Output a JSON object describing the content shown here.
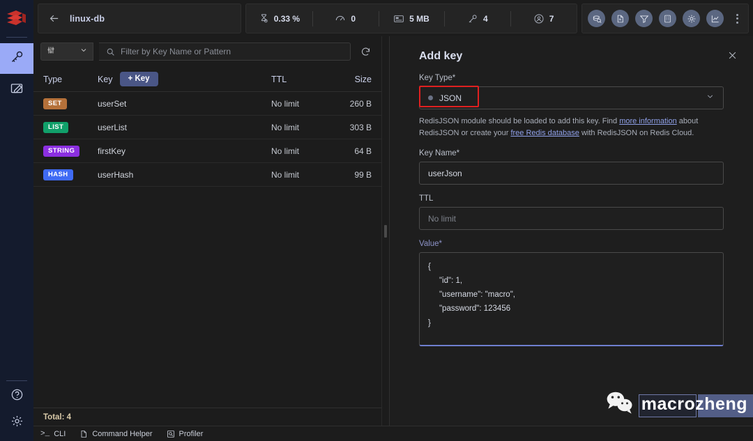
{
  "rail": {
    "logo_icon": "redis-logo",
    "items": [
      {
        "name": "browser",
        "icon": "key-icon",
        "active": true
      },
      {
        "name": "workbench",
        "icon": "edit-icon",
        "active": false
      }
    ],
    "bottom_items": [
      {
        "name": "help",
        "icon": "help-icon"
      },
      {
        "name": "settings",
        "icon": "gear-icon"
      }
    ]
  },
  "topbar": {
    "back_icon": "arrow-left-icon",
    "db_name": "linux-db",
    "stats": [
      {
        "icon": "hourglass-icon",
        "value": "0.33 %"
      },
      {
        "icon": "gauge-icon",
        "value": "0"
      },
      {
        "icon": "memory-icon",
        "value": "5 MB"
      },
      {
        "icon": "key-icon",
        "value": "4"
      },
      {
        "icon": "user-icon",
        "value": "7"
      }
    ],
    "tools": [
      {
        "name": "database-overview",
        "icon": "overview-icon"
      },
      {
        "name": "slowlog",
        "icon": "document-icon"
      },
      {
        "name": "pub-sub",
        "icon": "funnel-icon"
      },
      {
        "name": "cluster-details",
        "icon": "grid-icon"
      },
      {
        "name": "settings",
        "icon": "gear-icon"
      },
      {
        "name": "analysis-tools",
        "icon": "chart-icon"
      }
    ],
    "more_icon": "more-vertical-icon"
  },
  "keys_pane": {
    "filter": {
      "select_icon": "filter-icon",
      "caret_icon": "chevron-down-icon",
      "search_icon": "search-icon",
      "placeholder": "Filter by Key Name or Pattern",
      "value": "",
      "refresh_icon": "refresh-icon"
    },
    "columns": [
      "Type",
      "Key",
      "TTL",
      "Size"
    ],
    "add_key_label": "+ Key",
    "rows": [
      {
        "type": "SET",
        "type_color": "#b5713a",
        "key": "userSet",
        "ttl": "No limit",
        "size": "260 B"
      },
      {
        "type": "LIST",
        "type_color": "#11a06a",
        "key": "userList",
        "ttl": "No limit",
        "size": "303 B"
      },
      {
        "type": "STRING",
        "type_color": "#8b2fe0",
        "key": "firstKey",
        "ttl": "No limit",
        "size": "64 B"
      },
      {
        "type": "HASH",
        "type_color": "#3f6bf5",
        "key": "userHash",
        "ttl": "No limit",
        "size": "99 B"
      }
    ],
    "total_label": "Total: 4"
  },
  "panel": {
    "title": "Add key",
    "close_icon": "close-icon",
    "key_type": {
      "label": "Key Type*",
      "value": "JSON",
      "caret_icon": "chevron-down-icon",
      "highlight_color": "#e02020"
    },
    "helper": {
      "part1": "RedisJSON module should be loaded to add this key. Find ",
      "link1": "more information",
      "part2": " about RedisJSON or create your ",
      "link2": "free Redis database",
      "part3": " with RedisJSON on Redis Cloud."
    },
    "key_name": {
      "label": "Key Name*",
      "value": "userJson"
    },
    "ttl": {
      "label": "TTL",
      "placeholder": "No limit",
      "value": ""
    },
    "value_field": {
      "label": "Value*",
      "value": "{\n     \"id\": 1,\n     \"username\": \"macro\",\n     \"password\": 123456\n}"
    }
  },
  "bottombar": {
    "items": [
      {
        "name": "cli",
        "icon": "terminal-icon",
        "label": "CLI"
      },
      {
        "name": "command-helper",
        "icon": "document-icon",
        "label": "Command Helper"
      },
      {
        "name": "profiler",
        "icon": "profiler-icon",
        "label": "Profiler"
      }
    ]
  },
  "watermark": {
    "icon": "wechat-icon",
    "text": "macrozheng"
  }
}
